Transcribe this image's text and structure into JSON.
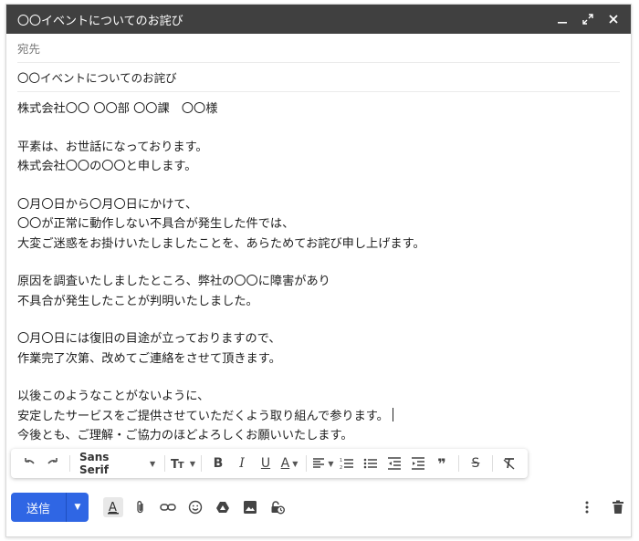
{
  "window": {
    "title": "〇〇イベントについてのお詫び",
    "minimize_icon": "minimize-icon",
    "expand_icon": "expand-icon",
    "close_icon": "close-icon"
  },
  "compose": {
    "to_label": "宛先",
    "subject": "〇〇イベントについてのお詫び",
    "body_lines": [
      "株式会社〇〇 〇〇部 〇〇課　〇〇様",
      "",
      "平素は、お世話になっております。",
      "株式会社〇〇の〇〇と申します。",
      "",
      "〇月〇日から〇月〇日にかけて、",
      "〇〇が正常に動作しない不具合が発生した件では、",
      "大変ご迷惑をお掛けいたしましたことを、あらためてお詫び申し上げます。",
      "",
      "原因を調査いたしましたところ、弊社の〇〇に障害があり",
      "不具合が発生したことが判明いたしました。",
      "",
      "〇月〇日には復旧の目途が立っておりますので、",
      "作業完了次第、改めてご連絡をさせて頂きます。",
      "",
      "以後このようなことがないように、",
      "安定したサービスをご提供させていただくよう取り組んで参ります。",
      "今後とも、ご理解・ご協力のほどよろしくお願いいたします。"
    ]
  },
  "format_toolbar": {
    "font": "Sans Serif"
  },
  "bottom_bar": {
    "send_label": "送信"
  },
  "colors": {
    "titlebar": "#404040",
    "send_button": "#2f66e4"
  }
}
